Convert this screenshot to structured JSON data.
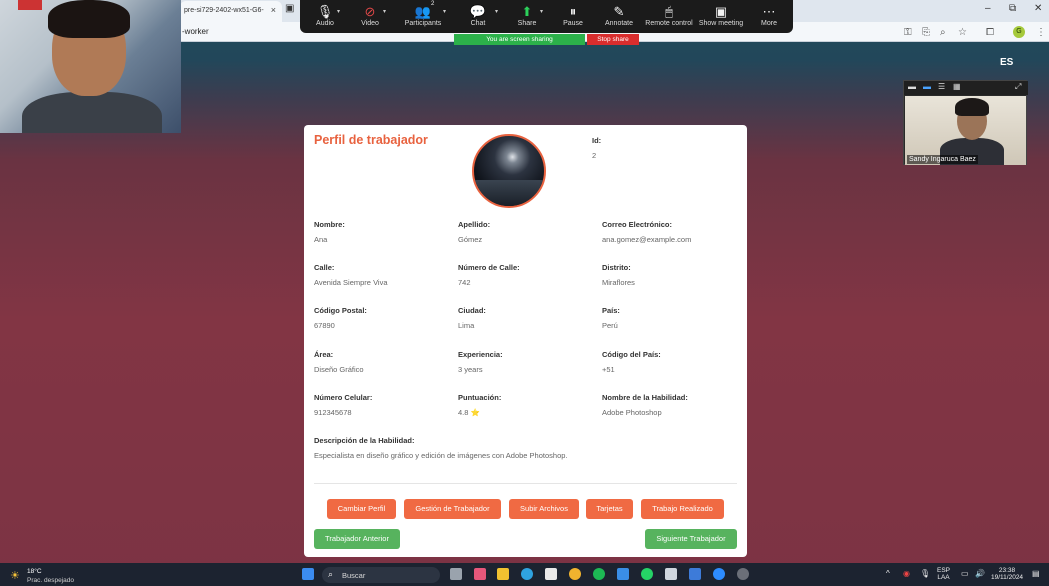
{
  "browser": {
    "tab_title": "pre-si729-2402-wx51-G6-",
    "address": "-worker"
  },
  "zoom_toolbar": {
    "items": [
      {
        "label": "Audio",
        "icon": "🎙"
      },
      {
        "label": "Video",
        "icon": "⊘"
      },
      {
        "label": "Participants",
        "icon": "👥"
      },
      {
        "label": "Chat",
        "icon": "💬"
      },
      {
        "label": "Share",
        "icon": "⬆"
      },
      {
        "label": "Pause",
        "icon": "⏸"
      },
      {
        "label": "Annotate",
        "icon": "✎"
      },
      {
        "label": "Remote control",
        "icon": "🖱"
      },
      {
        "label": "Show meeting",
        "icon": "▣"
      },
      {
        "label": "More",
        "icon": "⋯"
      }
    ],
    "participants_count": "2",
    "sharing_status": "You are screen sharing",
    "stop_share": "Stop share"
  },
  "language": "ES",
  "participant_thumb": {
    "name": "Sandy Ingaruca Baez"
  },
  "profile": {
    "title": "Perfil de trabajador",
    "id_label": "Id:",
    "id_value": "2",
    "fields": {
      "nombre": {
        "label": "Nombre:",
        "value": "Ana"
      },
      "apellido": {
        "label": "Apellido:",
        "value": "Gómez"
      },
      "correo": {
        "label": "Correo Electrónico:",
        "value": "ana.gomez@example.com"
      },
      "calle": {
        "label": "Calle:",
        "value": "Avenida Siempre Viva"
      },
      "numero_calle": {
        "label": "Número de Calle:",
        "value": "742"
      },
      "distrito": {
        "label": "Distrito:",
        "value": "Miraflores"
      },
      "codigo_postal": {
        "label": "Código Postal:",
        "value": "67890"
      },
      "ciudad": {
        "label": "Ciudad:",
        "value": "Lima"
      },
      "pais": {
        "label": "País:",
        "value": "Perú"
      },
      "area": {
        "label": "Área:",
        "value": "Diseño Gráfico"
      },
      "experiencia": {
        "label": "Experiencia:",
        "value": "3 years"
      },
      "codigo_pais": {
        "label": "Código del País:",
        "value": "+51"
      },
      "numero_celular": {
        "label": "Número Celular:",
        "value": "912345678"
      },
      "puntuacion": {
        "label": "Puntuación:",
        "value": "4.8",
        "star": "⭐"
      },
      "habilidad": {
        "label": "Nombre de la Habilidad:",
        "value": "Adobe Photoshop"
      },
      "descripcion": {
        "label": "Descripción de la Habilidad:",
        "value": "Especialista en diseño gráfico y edición de imágenes con Adobe Photoshop."
      }
    },
    "buttons": {
      "cambiar_perfil": "Cambiar Perfil",
      "gestion": "Gestión de Trabajador",
      "subir_archivos": "Subir Archivos",
      "tarjetas": "Tarjetas",
      "trabajo_realizado": "Trabajo Realizado",
      "anterior": "Trabajador Anterior",
      "siguiente": "Siguiente Trabajador"
    }
  },
  "taskbar": {
    "temperature": "18°C",
    "weather": "Prac. despejado",
    "search_placeholder": "Buscar",
    "lang_top": "ESP",
    "lang_bottom": "LAA",
    "time": "23:38",
    "date": "19/11/2024"
  },
  "colors": {
    "accent": "#e8623f",
    "button_orange": "#f06a43",
    "button_green": "#57b35e"
  }
}
